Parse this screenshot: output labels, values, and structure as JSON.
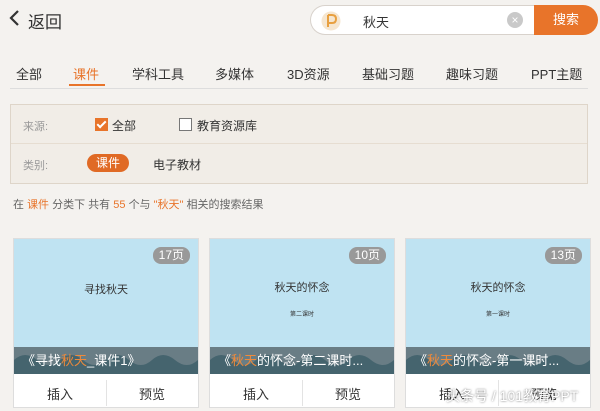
{
  "topbar": {
    "back_label": "返回",
    "search_value": "秋天",
    "search_button": "搜索"
  },
  "tabs": [
    {
      "label": "全部",
      "active": false
    },
    {
      "label": "课件",
      "active": true
    },
    {
      "label": "学科工具",
      "active": false
    },
    {
      "label": "多媒体",
      "active": false
    },
    {
      "label": "3D资源",
      "active": false
    },
    {
      "label": "基础习题",
      "active": false
    },
    {
      "label": "趣味习题",
      "active": false
    },
    {
      "label": "PPT主题",
      "active": false
    }
  ],
  "filter": {
    "source_label": "来源:",
    "source_all": "全部",
    "source_all_checked": true,
    "source_lib": "教育资源库",
    "source_lib_checked": false,
    "category_label": "类别:",
    "category_active": "课件",
    "category_other": "电子教材"
  },
  "summary": {
    "p1": "在",
    "category": "课件",
    "p2": "分类下 共有",
    "count": "55",
    "p3": "个与",
    "keyword": "\"秋天\"",
    "p4": "相关的搜索结果"
  },
  "cards": [
    {
      "pages": "17页",
      "thumb_title": "寻找秋天",
      "thumb_subtitle": "",
      "caption_pre": "《寻找",
      "caption_hl": "秋天",
      "caption_post": "_课件1》",
      "insert": "插入",
      "preview": "预览"
    },
    {
      "pages": "10页",
      "thumb_title": "秋天的怀念",
      "thumb_subtitle": "第二课时",
      "caption_pre": "《",
      "caption_hl": "秋天",
      "caption_post": "的怀念-第二课时...",
      "insert": "插入",
      "preview": "预览"
    },
    {
      "pages": "13页",
      "thumb_title": "秋天的怀念",
      "thumb_subtitle": "第一课时",
      "caption_pre": "《",
      "caption_hl": "秋天",
      "caption_post": "的怀念-第一课时...",
      "insert": "插入",
      "preview": "预览"
    }
  ],
  "watermark": "头条号 / 101教育PPT",
  "colors": {
    "accent": "#e8742a"
  }
}
